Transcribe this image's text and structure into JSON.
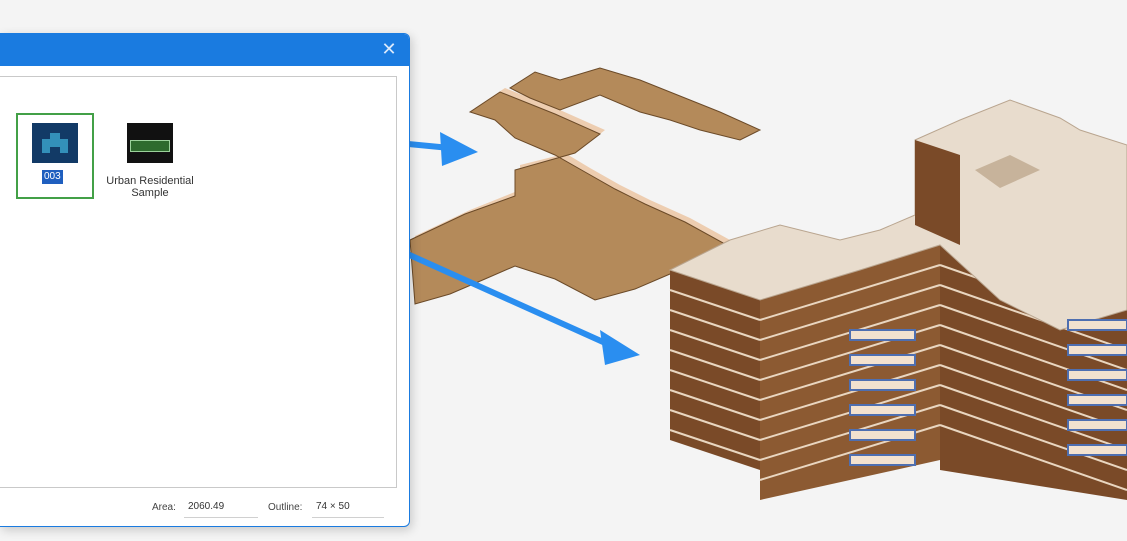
{
  "dialog": {
    "close_glyph": "✕",
    "items": [
      {
        "label": "003",
        "selected": true
      },
      {
        "label": "Urban Residential Sample"
      }
    ],
    "status": {
      "area_label": "Area:",
      "area_value": "2060.49",
      "outline_label": "Outline:",
      "outline_value": "74 × 50"
    }
  },
  "colors": {
    "accent": "#1a7be0",
    "selection_border": "#43a047",
    "arrow": "#2a8ef0",
    "floor_plate": "#b48a5a",
    "roof": "#e8dccd",
    "wall": "#7a4a28",
    "balcony": "#4f6fb0"
  }
}
